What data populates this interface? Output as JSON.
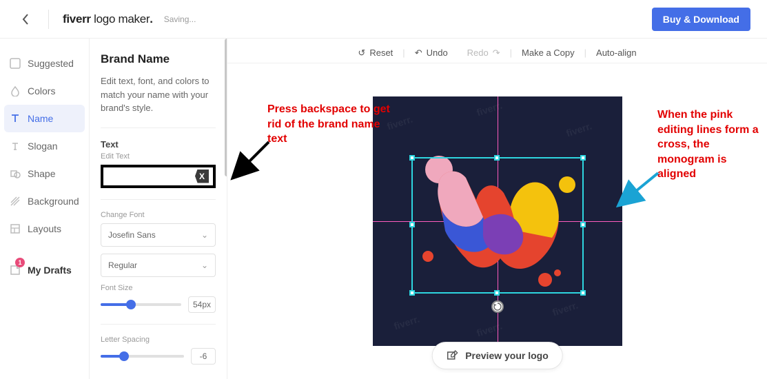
{
  "header": {
    "brand_bold": "fiverr",
    "brand_light": " logo maker",
    "brand_dot": ".",
    "saving": "Saving...",
    "buy_label": "Buy & Download"
  },
  "rail": {
    "items": [
      {
        "label": "Suggested",
        "icon": "suggested-icon"
      },
      {
        "label": "Colors",
        "icon": "drop-icon"
      },
      {
        "label": "Name",
        "icon": "text-icon",
        "active": true
      },
      {
        "label": "Slogan",
        "icon": "slogan-icon"
      },
      {
        "label": "Shape",
        "icon": "shape-icon"
      },
      {
        "label": "Background",
        "icon": "background-icon"
      },
      {
        "label": "Layouts",
        "icon": "layouts-icon"
      }
    ],
    "drafts_label": "My Drafts",
    "drafts_badge": "1"
  },
  "panel": {
    "title": "Brand Name",
    "desc": "Edit text, font, and colors to match your name with your brand's style.",
    "section_text": "Text",
    "edit_text_label": "Edit Text",
    "backspace_glyph": "X",
    "change_font_label": "Change Font",
    "font_family": "Josefin Sans",
    "font_weight": "Regular",
    "font_size_label": "Font Size",
    "font_size_value": "54px",
    "font_size_pct": 38,
    "letter_spacing_label": "Letter Spacing",
    "letter_spacing_value": "-6",
    "letter_spacing_pct": 28
  },
  "toolbar": {
    "reset": "Reset",
    "undo": "Undo",
    "redo": "Redo",
    "copy": "Make a Copy",
    "auto_align": "Auto-align"
  },
  "canvas": {
    "watermark_text": "fiverr.",
    "preview_label": "Preview your logo"
  },
  "annotations": {
    "left": "Press backspace to get rid of the brand name text",
    "right": "When the pink editing lines form a cross, the monogram is aligned"
  },
  "colors": {
    "accent": "#446ee7",
    "canvas_bg": "#1a1f3a",
    "guide": "#ff5cc0",
    "sel": "#2ed6e0"
  }
}
